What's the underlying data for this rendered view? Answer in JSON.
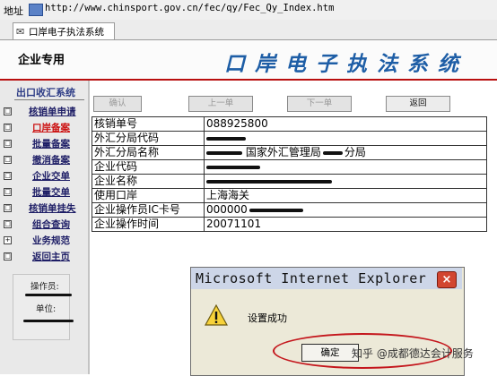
{
  "browser": {
    "address_label": "地址",
    "url": "http://www.chinsport.gov.cn/fec/qy/Fec_Qy_Index.htm",
    "tab_title": "口岸电子执法系统"
  },
  "header": {
    "left_label": "企业专用",
    "banner": "口岸电子执法系统"
  },
  "sidebar": {
    "title": "出口收汇系统",
    "items": [
      {
        "box": "□",
        "label": "核销单申请",
        "style": "underline"
      },
      {
        "box": "□",
        "label": "口岸备案",
        "style": "red-underline"
      },
      {
        "box": "□",
        "label": "批量备案",
        "style": "underline"
      },
      {
        "box": "□",
        "label": "撤消备案",
        "style": "underline"
      },
      {
        "box": "□",
        "label": "企业交单",
        "style": "underline"
      },
      {
        "box": "□",
        "label": "批量交单",
        "style": "underline"
      },
      {
        "box": "□",
        "label": "核销单挂失",
        "style": "underline"
      },
      {
        "box": "□",
        "label": "组合查询",
        "style": "underline"
      },
      {
        "box": "+",
        "label": "业务规范",
        "style": "plain"
      },
      {
        "box": "□",
        "label": "返回主页",
        "style": "underline"
      }
    ],
    "operator_label": "操作员:",
    "unit_label": "单位:"
  },
  "toolbar": {
    "confirm": "确认",
    "prev": "上一单",
    "next": "下一单",
    "back": "返回"
  },
  "info_table": [
    {
      "label": "核销单号",
      "value": "088925800"
    },
    {
      "label": "外汇分局代码",
      "value": "",
      "redacted": true
    },
    {
      "label": "外汇分局名称",
      "value_mid": "国家外汇管理局",
      "value_end": "分局"
    },
    {
      "label": "企业代码",
      "value": "",
      "redacted": true
    },
    {
      "label": "企业名称",
      "value": "",
      "redacted": true
    },
    {
      "label": "使用口岸",
      "value": "上海海关"
    },
    {
      "label": "企业操作员IC卡号",
      "value": "000000"
    },
    {
      "label": "企业操作时间",
      "value": "20071101"
    }
  ],
  "dialog": {
    "title": "Microsoft Internet Explorer",
    "close": "×",
    "message": "设置成功",
    "ok_label": "确定"
  },
  "watermark": "知乎 @成都德达会计服务",
  "colors": {
    "banner_text": "#1e5ea6",
    "accent_red": "#cc1111",
    "sidebar_title": "#2d3c86",
    "dialog_bg": "#ece9d8",
    "ok_circle": "#c4161c"
  },
  "icons": {
    "address": "ie-page-icon",
    "tab": "tab-page-icon",
    "warning": "warning-triangle-icon",
    "close": "close-x-icon"
  }
}
